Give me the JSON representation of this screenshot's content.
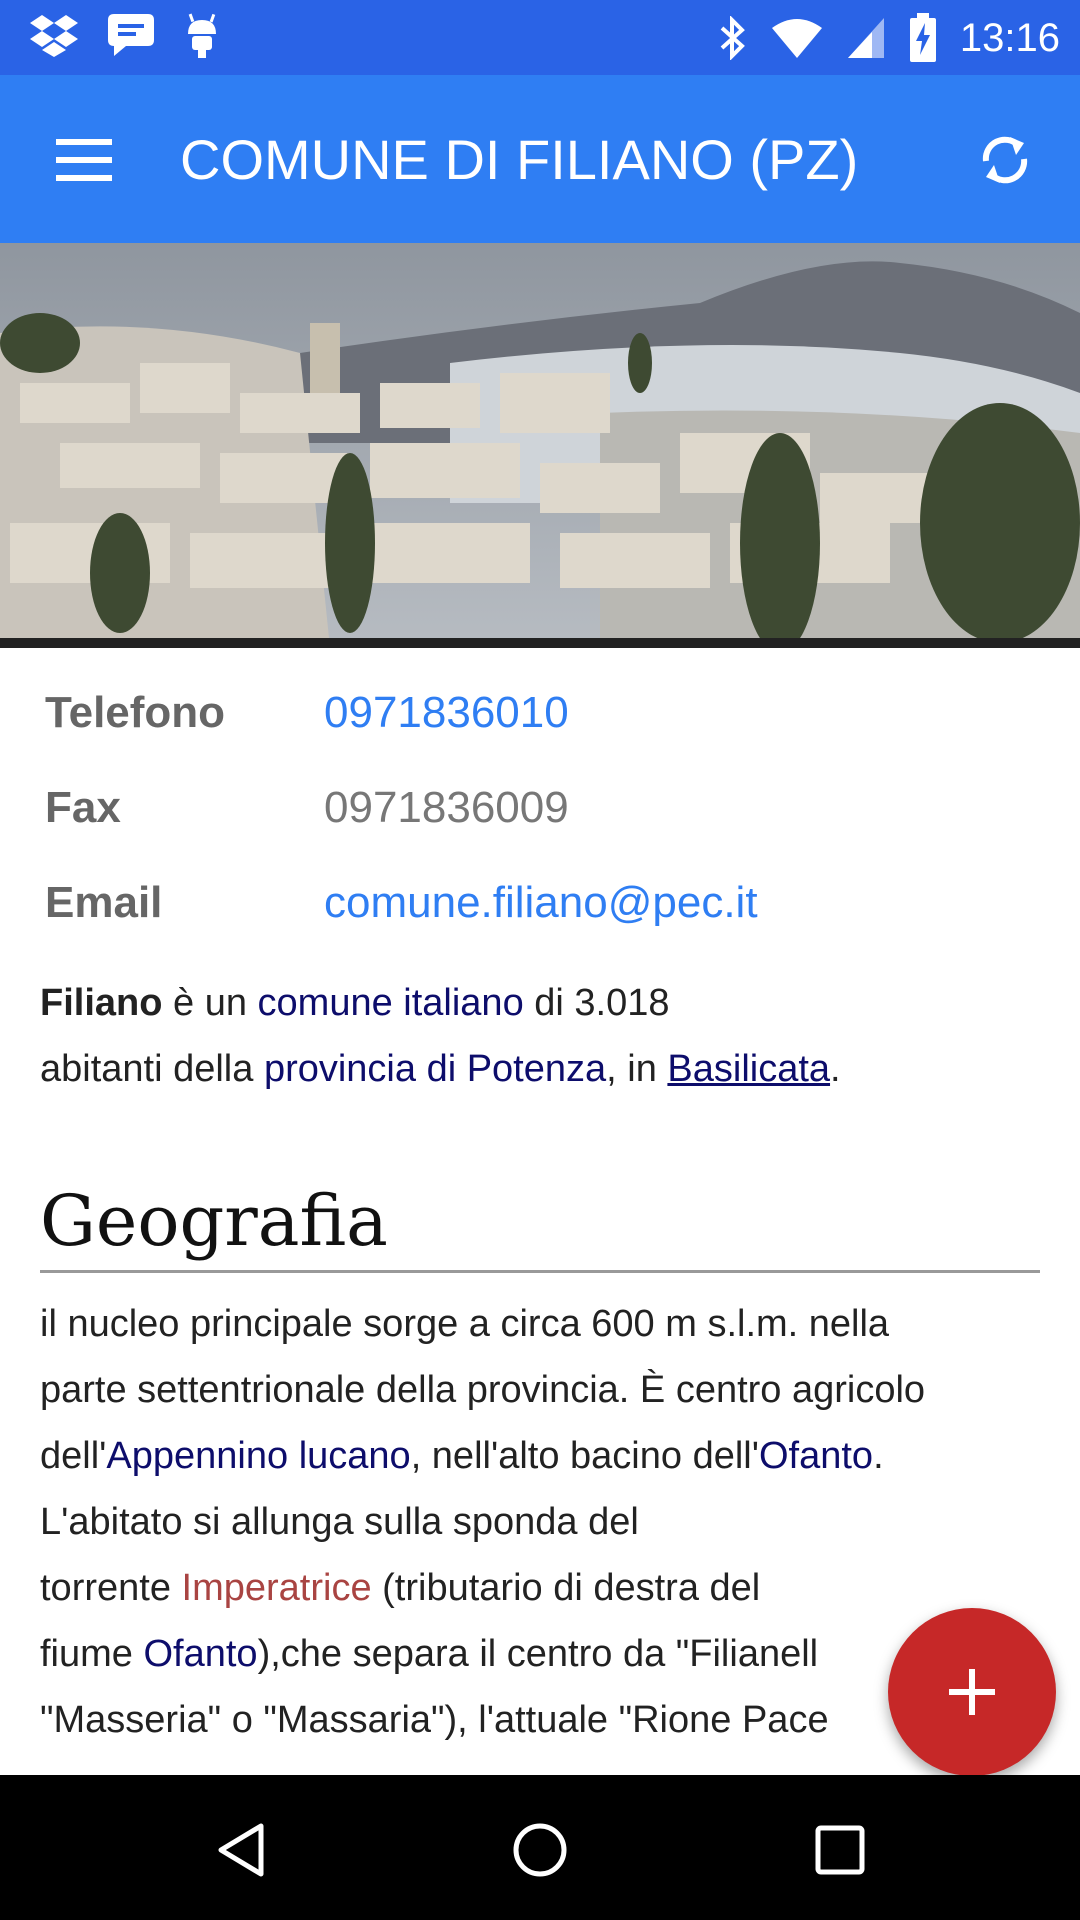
{
  "status_bar": {
    "time": "13:16",
    "left_icons": [
      "dropbox-icon",
      "message-icon",
      "android-icon"
    ],
    "right_icons": [
      "bluetooth-icon",
      "wifi-icon",
      "signal-icon",
      "battery-charging-icon"
    ]
  },
  "app_bar": {
    "title": "COMUNE DI FILIANO (PZ)",
    "menu_icon": "hamburger-menu-icon",
    "refresh_icon": "refresh-icon",
    "color": "#2f7ef3"
  },
  "hero": {
    "description_icon": "town-photo"
  },
  "contacts": {
    "phone_label": "Telefono",
    "phone_value": "0971836010",
    "fax_label": "Fax",
    "fax_value": "0971836009",
    "email_label": "Email",
    "email_value": "comune.filiano@pec.it"
  },
  "intro": {
    "bold": "Filiano",
    "t1": " è un ",
    "link1": "comune italiano",
    "t2": " di 3.018",
    "t3": "abitanti della ",
    "link2": "provincia di Potenza",
    "t4": ", in ",
    "link3": "Basilicata",
    "t5": "."
  },
  "geografia": {
    "heading": "Geografia",
    "l1": "il nucleo principale sorge a circa 600 m s.l.m. nella",
    "l2": "parte settentrionale della provincia. È centro agricolo",
    "l3a": "dell'",
    "l3link1": "Appennino lucano",
    "l3b": ", nell'alto bacino dell'",
    "l3link2": "Ofanto",
    "l3c": ".",
    "l4": "L'abitato si allunga sulla sponda del",
    "l5a": "torrente ",
    "l5link": "Imperatrice",
    "l5b": " (tributario di destra del",
    "l6a": "fiume ",
    "l6link": "Ofanto",
    "l6b": "),che separa il centro da \"Filianell",
    "l7": "\"Masseria\" o \"Massaria\"), l'attuale \"Rione Pace"
  },
  "fab": {
    "icon": "plus-icon",
    "color": "#c62828"
  },
  "nav_bar": {
    "back_icon": "back-icon",
    "home_icon": "home-icon",
    "recents_icon": "recents-icon"
  }
}
